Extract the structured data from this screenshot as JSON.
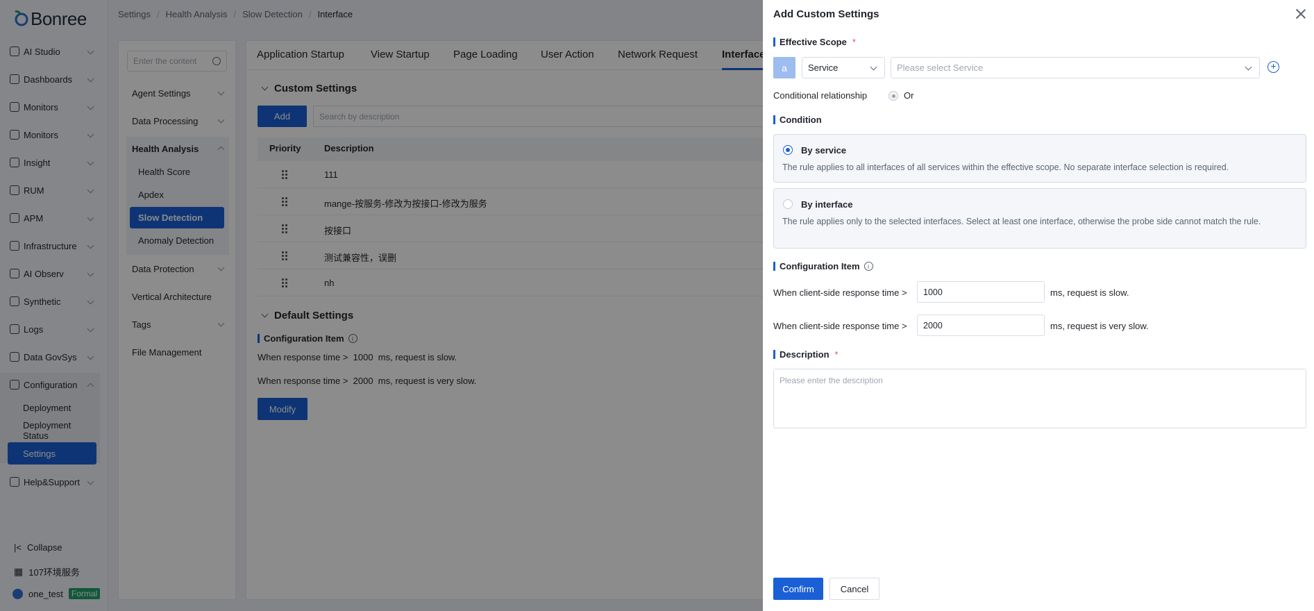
{
  "app": {
    "logo_text": "Bonree"
  },
  "breadcrumb": [
    "Settings",
    "Health Analysis",
    "Slow Detection",
    "Interface"
  ],
  "sidebar": {
    "items": [
      {
        "label": "AI Studio",
        "icon": "ai-studio-icon"
      },
      {
        "label": "Dashboards",
        "icon": "dashboard-icon"
      },
      {
        "label": "Monitors",
        "icon": "monitor-icon"
      },
      {
        "label": "Monitors",
        "icon": "monitor-icon"
      },
      {
        "label": "Insight",
        "icon": "insight-icon"
      },
      {
        "label": "RUM",
        "icon": "rum-icon"
      },
      {
        "label": "APM",
        "icon": "apm-icon"
      },
      {
        "label": "Infrastructure",
        "icon": "infrastructure-icon"
      },
      {
        "label": "AI Observ",
        "icon": "ai-observ-icon"
      },
      {
        "label": "Synthetic",
        "icon": "synthetic-icon"
      },
      {
        "label": "Logs",
        "icon": "logs-icon"
      },
      {
        "label": "Data GovSys",
        "icon": "data-govsys-icon"
      },
      {
        "label": "Configuration",
        "icon": "configuration-icon"
      },
      {
        "label": "Help&Support",
        "icon": "help-icon"
      }
    ],
    "config_sub": [
      "Deployment",
      "Deployment Status",
      "Settings"
    ],
    "footer": {
      "collapse": "Collapse",
      "env": "107环境服务",
      "user": "one_test",
      "badge": "Formal"
    }
  },
  "settings_nav": {
    "search_placeholder": "Enter the content",
    "items": [
      "Agent Settings",
      "Data Processing",
      "Health Analysis",
      "Data Protection",
      "Vertical Architecture",
      "Tags",
      "File Management"
    ],
    "health_sub": [
      "Health Score",
      "Apdex",
      "Slow Detection",
      "Anomaly Detection"
    ]
  },
  "tabs": [
    "Application Startup",
    "View Startup",
    "Page Loading",
    "User Action",
    "Network Request",
    "Interface"
  ],
  "custom": {
    "title": "Custom Settings",
    "add_label": "Add",
    "search_placeholder": "Search by description",
    "columns": [
      "Priority",
      "Description"
    ],
    "rows": [
      "111",
      "mange-按服务-修改为按接口-修改为服务",
      "按接口",
      "测试兼容性，误删",
      "nh"
    ]
  },
  "default": {
    "title": "Default Settings",
    "config_label": "Configuration Item",
    "line1": "When response time >  1000  ms, request is slow.",
    "line2": "When response time >  2000  ms, request is very slow.",
    "modify_label": "Modify"
  },
  "drawer": {
    "title": "Add Custom Settings",
    "scope_label": "Effective Scope",
    "scope_chip": "a",
    "scope_type": "Service",
    "scope_placeholder": "Please select Service",
    "cond_rel_label": "Conditional relationship",
    "cond_rel_value": "Or",
    "condition_label": "Condition",
    "by_service_title": "By service",
    "by_service_desc": "The rule applies to all interfaces of all services within the effective scope. No separate interface selection is required.",
    "by_interface_title": "By interface",
    "by_interface_desc": "The rule applies only to the selected interfaces. Select at least one interface, otherwise the probe side cannot match the rule.",
    "config_label": "Configuration Item",
    "slow_prefix": "When client-side response time >",
    "slow_value": "1000",
    "slow_suffix": "ms, request is slow.",
    "vslow_prefix": "When client-side response time >",
    "vslow_value": "2000",
    "vslow_suffix": "ms, request is very slow.",
    "desc_label": "Description",
    "desc_placeholder": "Please enter the description",
    "confirm_label": "Confirm",
    "cancel_label": "Cancel"
  },
  "colors": {
    "primary": "#1a5fd6",
    "required": "#e34d4d"
  }
}
